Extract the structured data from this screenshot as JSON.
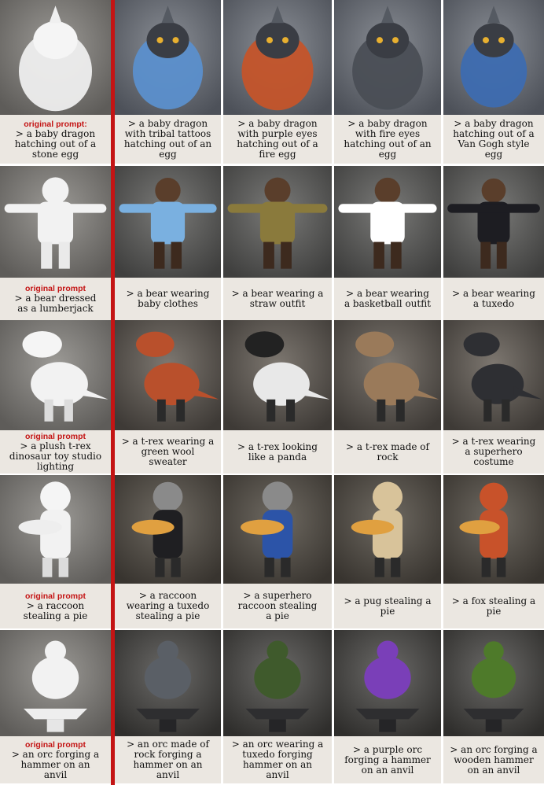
{
  "rows": [
    {
      "cells": [
        {
          "original_label": "original prompt:",
          "prompt": "> a baby dragon\nhatching out of a\nstone egg"
        },
        {
          "prompt": "> a baby dragon\nwith tribal tattoos\nhatching out of an\negg"
        },
        {
          "prompt": "> a baby dragon\nwith purple eyes\nhatching out of a\nfire egg"
        },
        {
          "prompt": "> a baby dragon\nwith fire eyes\nhatching out of an\negg"
        },
        {
          "prompt": "> a baby dragon\nhatching out of a\nVan Gogh style\negg"
        }
      ]
    },
    {
      "cells": [
        {
          "original_label": "original prompt",
          "prompt": "> a bear dressed\nas a lumberjack"
        },
        {
          "prompt": "> a bear wearing\nbaby clothes"
        },
        {
          "prompt": "> a bear wearing a\nstraw outfit"
        },
        {
          "prompt": "> a bear wearing\na basketball outfit"
        },
        {
          "prompt": "> a bear wearing\na tuxedo"
        }
      ]
    },
    {
      "cells": [
        {
          "original_label": "original prompt",
          "prompt": "> a plush t-rex\ndinosaur toy studio\nlighting"
        },
        {
          "prompt": "> a t-rex wearing a\ngreen wool\nsweater"
        },
        {
          "prompt": "> a t-rex looking\nlike a panda"
        },
        {
          "prompt": "> a t-rex made of\nrock"
        },
        {
          "prompt": "> a t-rex wearing\na superhero\ncostume"
        }
      ]
    },
    {
      "cells": [
        {
          "original_label": "original prompt",
          "prompt": "> a raccoon\nstealing a pie"
        },
        {
          "prompt": "> a raccoon\nwearing a tuxedo\nstealing a pie"
        },
        {
          "prompt": "> a superhero\nraccoon stealing\na pie"
        },
        {
          "prompt": "> a pug stealing a\npie"
        },
        {
          "prompt": "> a fox stealing a\npie"
        }
      ]
    },
    {
      "cells": [
        {
          "original_label": "original prompt",
          "prompt": "> an orc forging a\nhammer on an\nanvil"
        },
        {
          "prompt": "> an orc made of\nrock forging a\nhammer on an\nanvil"
        },
        {
          "prompt": "> an orc wearing a\ntuxedo forging\nhammer on an\nanvil"
        },
        {
          "prompt": "> a purple orc\nforging a hammer\non an anvil"
        },
        {
          "prompt": "> an orc forging a\nwooden hammer\non an anvil"
        }
      ]
    }
  ],
  "colors": {
    "accent": "#c41414",
    "caption_bg": "#ebe7e1"
  }
}
